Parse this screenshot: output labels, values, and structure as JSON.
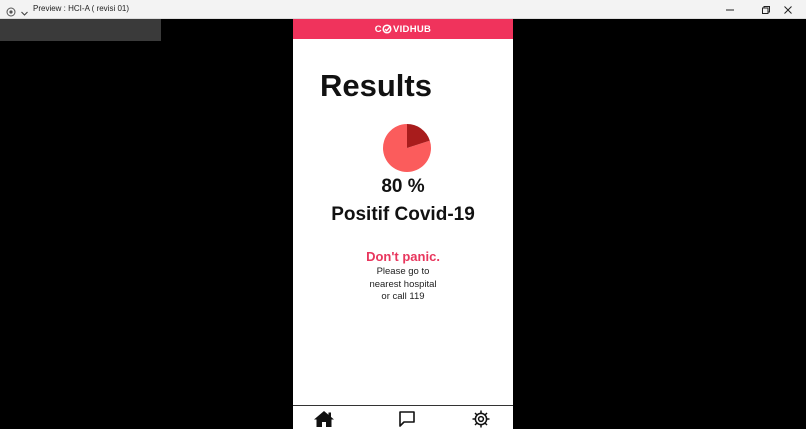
{
  "window": {
    "title": "Preview : HCI-A ( revisi 01)",
    "icons": [
      "app-icon",
      "chevron-down-icon",
      "minimize-icon",
      "restore-icon",
      "close-icon"
    ]
  },
  "app": {
    "brand": {
      "prefix": "C",
      "suffix": "VIDHUB"
    },
    "page_title": "Results",
    "result": {
      "percent_text": "80 %",
      "positive_fraction": 0.8,
      "label": "Positif Covid-19"
    },
    "message": {
      "headline": "Don't panic.",
      "lines": [
        "Please go to",
        "nearest hospital",
        "or call 119"
      ]
    },
    "nav": {
      "items": [
        "home-icon",
        "chat-icon",
        "settings-icon"
      ]
    }
  },
  "colors": {
    "header": "#f0335c",
    "pie_positive": "#fb5c5c",
    "pie_negative": "#a81c1c",
    "panic_text": "#e8365d",
    "window_background": "#000000"
  }
}
